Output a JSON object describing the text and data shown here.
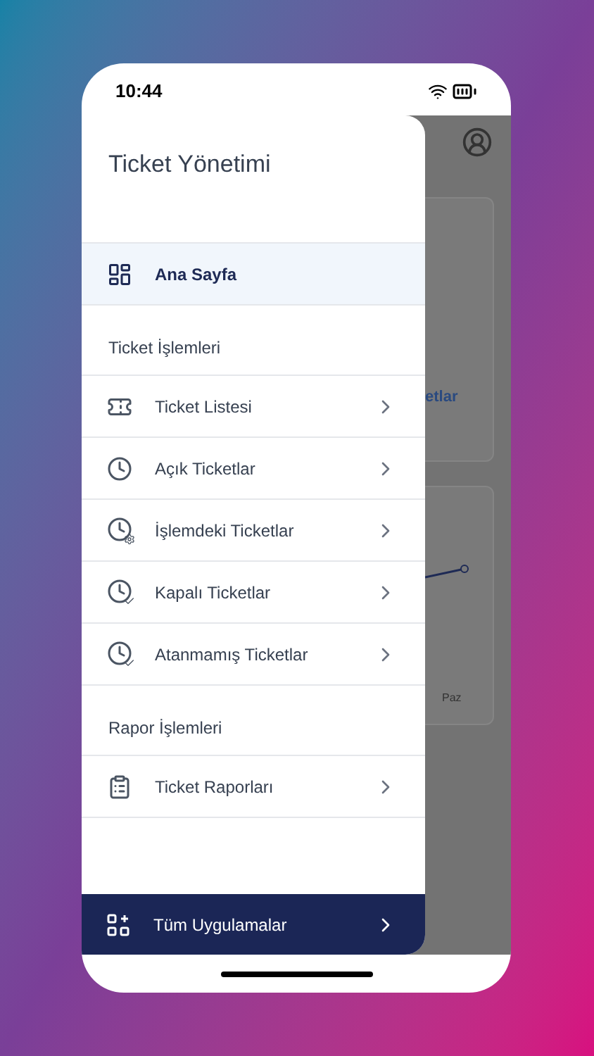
{
  "status_bar": {
    "time": "10:44"
  },
  "drawer": {
    "title": "Ticket Yönetimi",
    "home": {
      "label": "Ana Sayfa",
      "kind": "dashboard",
      "selected": true
    },
    "sections": [
      {
        "title": "Ticket İşlemleri",
        "items": [
          {
            "label": "Ticket Listesi",
            "kind": "ticket",
            "selected": false
          },
          {
            "label": "Açık Ticketlar",
            "kind": "clock",
            "selected": false
          },
          {
            "label": "İşlemdeki Ticketlar",
            "kind": "clock-gear",
            "selected": false
          },
          {
            "label": "Kapalı Ticketlar",
            "kind": "clock-check",
            "selected": false
          },
          {
            "label": "Atanmamış Ticketlar",
            "kind": "clock-check",
            "selected": false
          }
        ]
      },
      {
        "title": "Rapor İşlemleri",
        "items": [
          {
            "label": "Ticket Raporları",
            "kind": "clipboard",
            "selected": false
          }
        ]
      }
    ],
    "footer": {
      "label": "Tüm Uygulamalar"
    }
  },
  "background_page": {
    "link_fragment": "etlar",
    "axis_label": "Paz"
  }
}
